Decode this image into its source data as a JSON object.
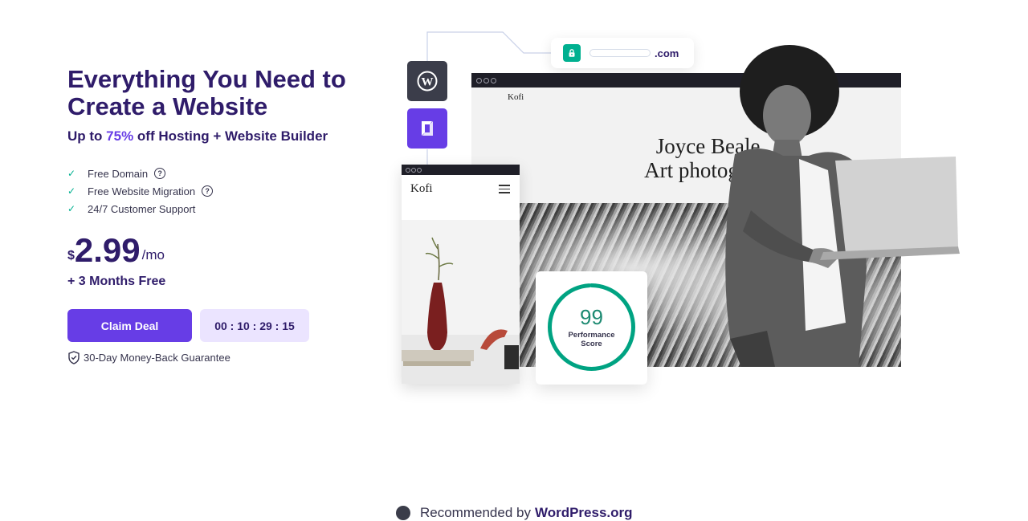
{
  "hero": {
    "title": "Everything You Need to Create a Website",
    "subtitle_prefix": "Up to ",
    "subtitle_discount": "75%",
    "subtitle_suffix": " off Hosting + Website Builder",
    "features": [
      {
        "label": "Free Domain",
        "has_help": true
      },
      {
        "label": "Free Website Migration",
        "has_help": true
      },
      {
        "label": "24/7 Customer Support",
        "has_help": false
      }
    ],
    "price": {
      "currency": "$",
      "amount": "2.99",
      "period": "/mo"
    },
    "bonus": "+ 3 Months Free",
    "cta_label": "Claim Deal",
    "countdown": "00 : 10 : 29 : 15",
    "guarantee": "30-Day Money-Back Guarantee"
  },
  "illustration": {
    "url_tld": ".com",
    "desktop_brand": "Kofi",
    "desktop_heading_line1": "Joyce Beale,",
    "desktop_heading_line2": "Art photograph",
    "mobile_brand": "Kofi",
    "performance_score": "99",
    "performance_label": "Performance Score",
    "performance_fraction": 0.99
  },
  "footer": {
    "recommended_prefix": "Recommended by",
    "recommended_brand": "WordPress.org"
  },
  "colors": {
    "brand_dark": "#2f1c6a",
    "brand_purple": "#673de6",
    "timer_bg": "#ebe4ff",
    "success_green": "#00b090",
    "text_muted": "#36344d"
  }
}
